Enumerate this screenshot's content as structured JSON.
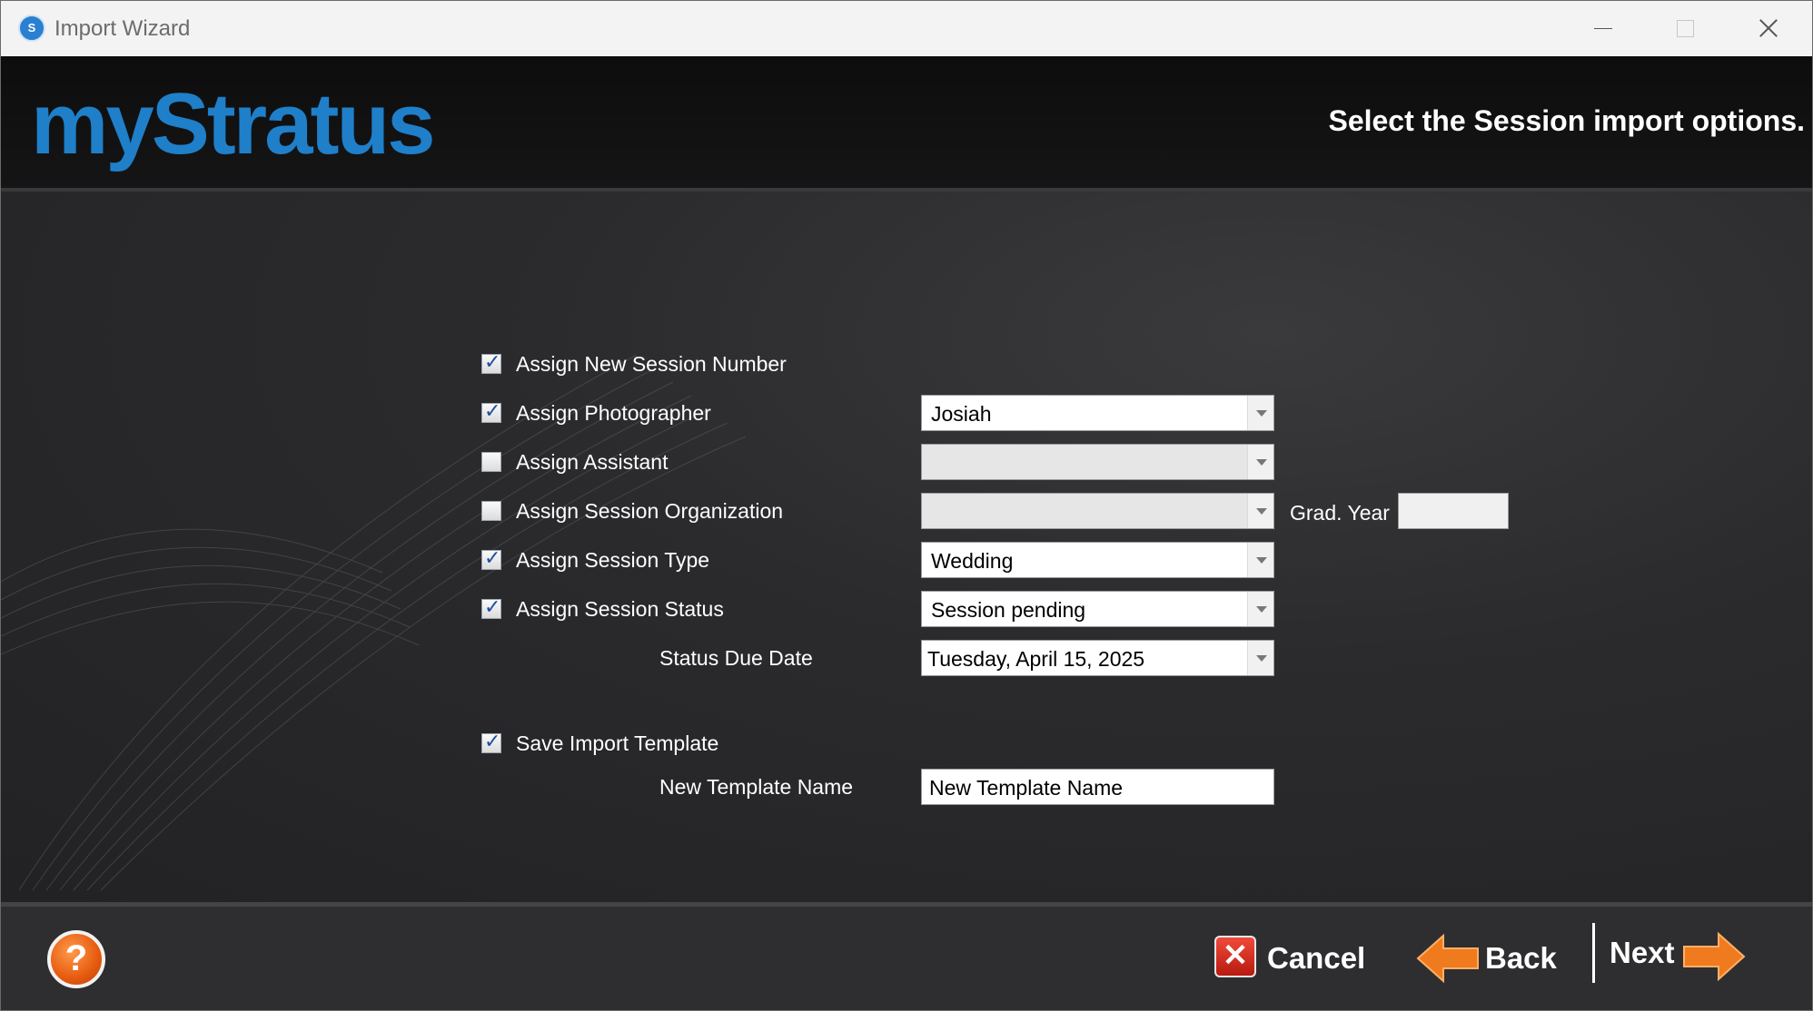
{
  "window": {
    "title": "Import Wizard",
    "app_icon_text": "S"
  },
  "header": {
    "logo": "myStratus",
    "instruction": "Select the Session import options."
  },
  "options": {
    "assign_new_session_number": {
      "label": "Assign New Session Number",
      "checked": true
    },
    "assign_photographer": {
      "label": "Assign Photographer",
      "checked": true,
      "value": "Josiah"
    },
    "assign_assistant": {
      "label": "Assign Assistant",
      "checked": false,
      "value": ""
    },
    "assign_session_organization": {
      "label": "Assign Session Organization",
      "checked": false,
      "value": ""
    },
    "grad_year": {
      "label": "Grad. Year",
      "value": ""
    },
    "assign_session_type": {
      "label": "Assign Session Type",
      "checked": true,
      "value": "Wedding"
    },
    "assign_session_status": {
      "label": "Assign Session Status",
      "checked": true,
      "value": "Session pending"
    },
    "status_due_date": {
      "label": "Status Due Date",
      "value": "Tuesday, April 15, 2025"
    },
    "save_import_template": {
      "label": "Save Import Template",
      "checked": true
    },
    "new_template_name": {
      "label": "New Template Name",
      "value": "New Template Name"
    }
  },
  "footer": {
    "help_glyph": "?",
    "cancel_label": "Cancel",
    "back_label": "Back",
    "next_label": "Next"
  },
  "colors": {
    "brand_blue": "#1f7fc9",
    "accent_orange": "#f07a1e",
    "cancel_red": "#d42a1c"
  }
}
